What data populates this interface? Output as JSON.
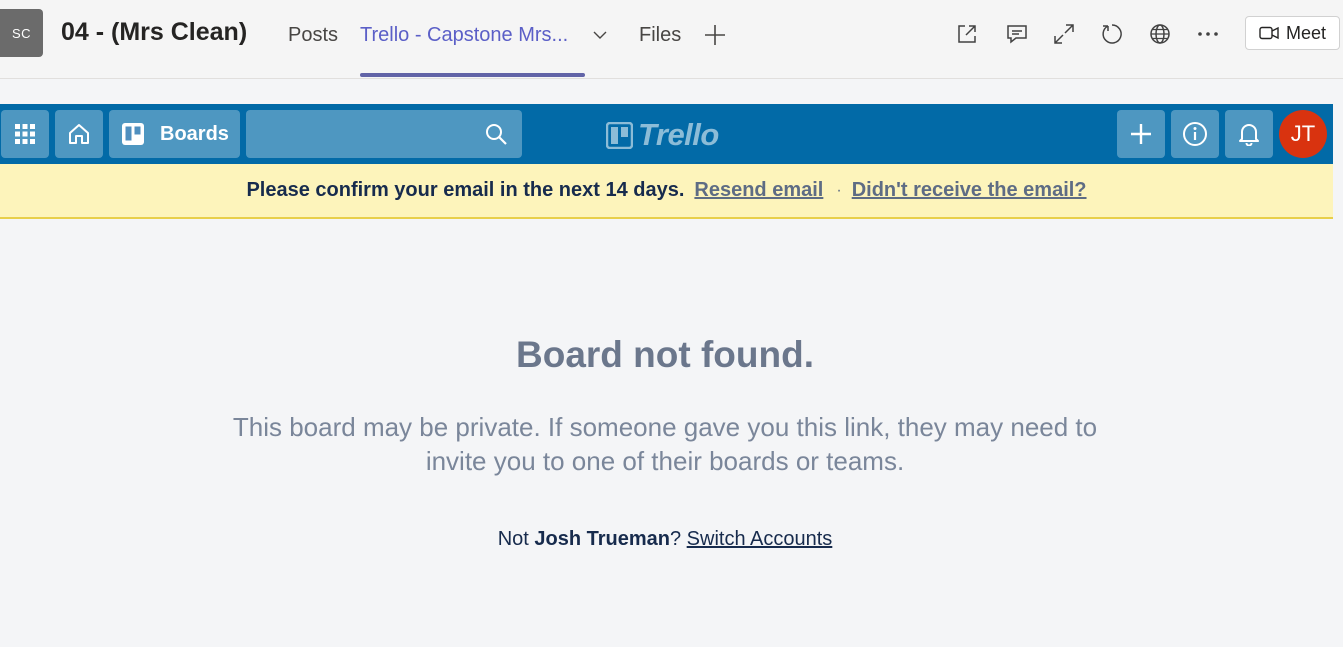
{
  "teams": {
    "team_avatar": "SC",
    "channel_title": "04 - (Mrs Clean)",
    "tabs": [
      {
        "label": "Posts"
      },
      {
        "label": "Trello - Capstone Mrs..."
      },
      {
        "label": "Files"
      }
    ],
    "meet_label": "Meet",
    "icons": [
      "popout-icon",
      "conversation-icon",
      "expand-icon",
      "reload-icon",
      "globe-icon",
      "more-icon"
    ]
  },
  "trello_nav": {
    "boards_label": "Boards",
    "logo_text": "Trello",
    "avatar_initials": "JT",
    "accent_color": "#026aa7",
    "avatar_color": "#d9330f"
  },
  "banner": {
    "message": "Please confirm your email in the next 14 days.",
    "resend_link": "Resend email",
    "separator": "·",
    "help_link": "Didn't receive the email?"
  },
  "main": {
    "heading": "Board not found.",
    "description": "This board may be private. If someone gave you this link, they may need to invite you to one of their boards or teams.",
    "not_prefix": "Not ",
    "user_name": "Josh Trueman",
    "question": "?",
    "switch_link": "Switch Accounts"
  }
}
